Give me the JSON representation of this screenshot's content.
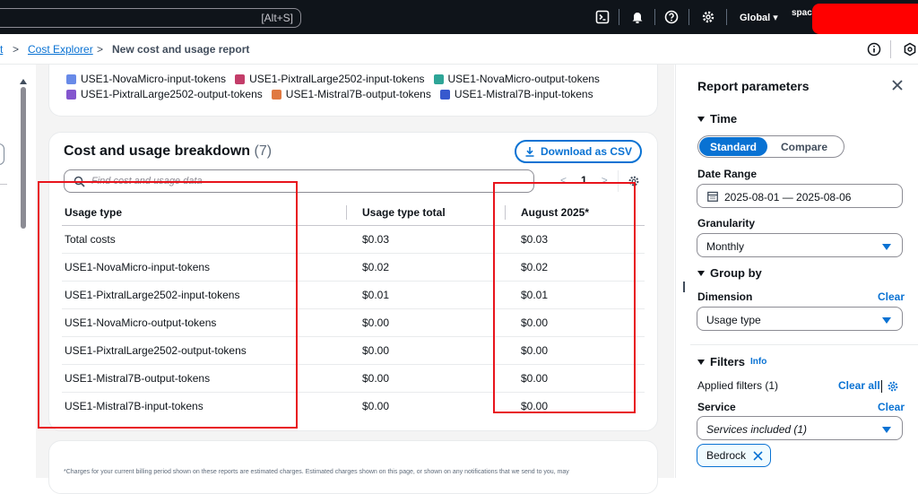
{
  "topnav": {
    "search_shortcut": "[Alt+S]",
    "region": "Global ▾",
    "account_partial": "spac"
  },
  "breadcrumb": {
    "parent_partial": "t",
    "link": "Cost Explorer",
    "current": "New cost and usage report"
  },
  "legend": {
    "row1": [
      {
        "label": "USE1-NovaMicro-input-tokens",
        "color": "#688ae8"
      },
      {
        "label": "USE1-PixtralLarge2502-input-tokens",
        "color": "#c33d69"
      },
      {
        "label": "USE1-NovaMicro-output-tokens",
        "color": "#2ea597"
      }
    ],
    "row2": [
      {
        "label": "USE1-PixtralLarge2502-output-tokens",
        "color": "#8456ce"
      },
      {
        "label": "USE1-Mistral7B-output-tokens",
        "color": "#e07941"
      },
      {
        "label": "USE1-Mistral7B-input-tokens",
        "color": "#3759ce"
      }
    ]
  },
  "breakdown": {
    "title": "Cost and usage breakdown",
    "count": "(7)",
    "download_label": "Download as CSV",
    "search_placeholder": "Find cost and usage data",
    "page": "1",
    "columns": [
      "Usage type",
      "Usage type total",
      "August 2025*"
    ],
    "rows": [
      [
        "Total costs",
        "$0.03",
        "$0.03"
      ],
      [
        "USE1-NovaMicro-input-tokens",
        "$0.02",
        "$0.02"
      ],
      [
        "USE1-PixtralLarge2502-input-tokens",
        "$0.01",
        "$0.01"
      ],
      [
        "USE1-NovaMicro-output-tokens",
        "$0.00",
        "$0.00"
      ],
      [
        "USE1-PixtralLarge2502-output-tokens",
        "$0.00",
        "$0.00"
      ],
      [
        "USE1-Mistral7B-output-tokens",
        "$0.00",
        "$0.00"
      ],
      [
        "USE1-Mistral7B-input-tokens",
        "$0.00",
        "$0.00"
      ]
    ]
  },
  "footnote": "*Charges for your current billing period shown on these reports are estimated charges. Estimated charges shown on this page, or shown on any notifications that we send to you, may",
  "params": {
    "title": "Report parameters",
    "time_section": "Time",
    "seg_standard": "Standard",
    "seg_compare": "Compare",
    "date_range_label": "Date Range",
    "date_range_value": "2025-08-01 — 2025-08-06",
    "granularity_label": "Granularity",
    "granularity_value": "Monthly",
    "groupby_section": "Group by",
    "dimension_label": "Dimension",
    "dimension_clear": "Clear",
    "dimension_value": "Usage type",
    "filters_section": "Filters",
    "filters_info": "Info",
    "applied_filters": "Applied filters (1)",
    "clear_all": "Clear all",
    "service_label": "Service",
    "service_clear": "Clear",
    "service_value": "Services included (1)",
    "token_label": "Bedrock"
  },
  "colors": {
    "accent": "#0972d3",
    "annotation": "#e8141c",
    "redaction": "#ff0000"
  }
}
